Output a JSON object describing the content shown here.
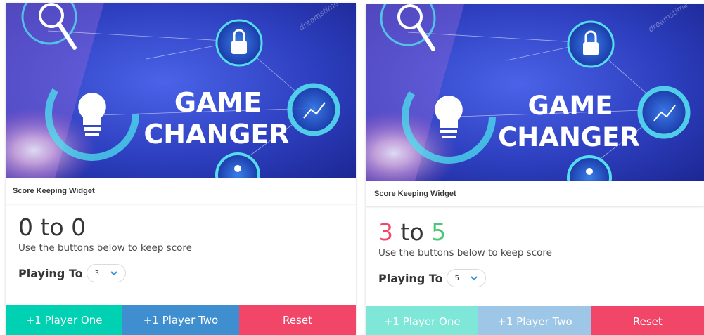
{
  "colors": {
    "player_one": "#00d1b2",
    "player_two": "#3e8ed0",
    "reset": "#f14668",
    "winner_red": "#f14668",
    "winner_green": "#48c774",
    "hero_bg": "#2c3fc8"
  },
  "widgets": [
    {
      "hero": {
        "line1": "GAME",
        "line2": "CHANGER",
        "watermark": "dreamstime"
      },
      "header": {
        "title": "Score Keeping Widget"
      },
      "score": {
        "player_one": "0",
        "separator": "to",
        "player_two": "0"
      },
      "subtitle": "Use the buttons below to keep score",
      "playing_to": {
        "label": "Playing To",
        "value": "3"
      },
      "buttons": {
        "player_one": "+1 Player One",
        "player_two": "+1 Player Two",
        "reset": "Reset"
      }
    },
    {
      "hero": {
        "line1": "GAME",
        "line2": "CHANGER",
        "watermark": "dreamstime"
      },
      "header": {
        "title": "Score Keeping Widget"
      },
      "score": {
        "player_one": "3",
        "separator": "to",
        "player_two": "5"
      },
      "subtitle": "Use the buttons below to keep score",
      "playing_to": {
        "label": "Playing To",
        "value": "5"
      },
      "buttons": {
        "player_one": "+1 Player One",
        "player_two": "+1 Player Two",
        "reset": "Reset"
      }
    }
  ]
}
